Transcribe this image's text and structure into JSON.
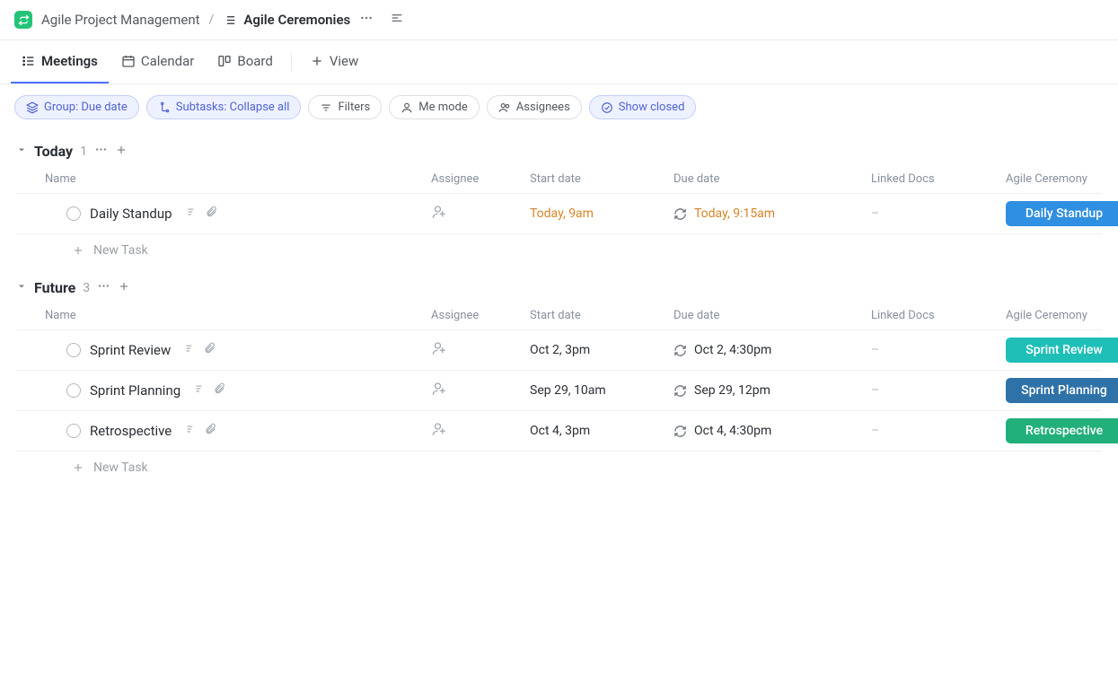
{
  "breadcrumb": {
    "space": "Agile Project Management",
    "list": "Agile Ceremonies"
  },
  "tabs": [
    {
      "label": "Meetings",
      "active": true,
      "icon": "list-icon"
    },
    {
      "label": "Calendar",
      "active": false,
      "icon": "calendar-icon"
    },
    {
      "label": "Board",
      "active": false,
      "icon": "board-icon"
    },
    {
      "label": "View",
      "active": false,
      "icon": "plus-icon"
    }
  ],
  "filters": {
    "group": "Group: Due date",
    "subtasks": "Subtasks: Collapse all",
    "filters": "Filters",
    "me_mode": "Me mode",
    "assignees": "Assignees",
    "show_closed": "Show closed"
  },
  "columns": [
    "Name",
    "Assignee",
    "Start date",
    "Due date",
    "Linked Docs",
    "Agile Ceremony"
  ],
  "groups": [
    {
      "title": "Today",
      "count": "1",
      "tasks": [
        {
          "name": "Daily Standup",
          "start": "Today, 9am",
          "start_orange": true,
          "due": "Today, 9:15am",
          "due_orange": true,
          "recur": true,
          "linked": "–",
          "badge": "Daily Standup",
          "badge_color": "#2f8fe0"
        }
      ],
      "new_task": "New Task"
    },
    {
      "title": "Future",
      "count": "3",
      "tasks": [
        {
          "name": "Sprint Review",
          "start": "Oct 2, 3pm",
          "start_orange": false,
          "due": "Oct 2, 4:30pm",
          "due_orange": false,
          "recur": true,
          "linked": "–",
          "badge": "Sprint Review",
          "badge_color": "#1fbfb8"
        },
        {
          "name": "Sprint Planning",
          "start": "Sep 29, 10am",
          "start_orange": false,
          "due": "Sep 29, 12pm",
          "due_orange": false,
          "recur": true,
          "linked": "–",
          "badge": "Sprint Planning",
          "badge_color": "#2f72a8"
        },
        {
          "name": "Retrospective",
          "start": "Oct 4, 3pm",
          "start_orange": false,
          "due": "Oct 4, 4:30pm",
          "due_orange": false,
          "recur": true,
          "linked": "–",
          "badge": "Retrospective",
          "badge_color": "#21b07a"
        }
      ],
      "new_task": "New Task"
    }
  ]
}
